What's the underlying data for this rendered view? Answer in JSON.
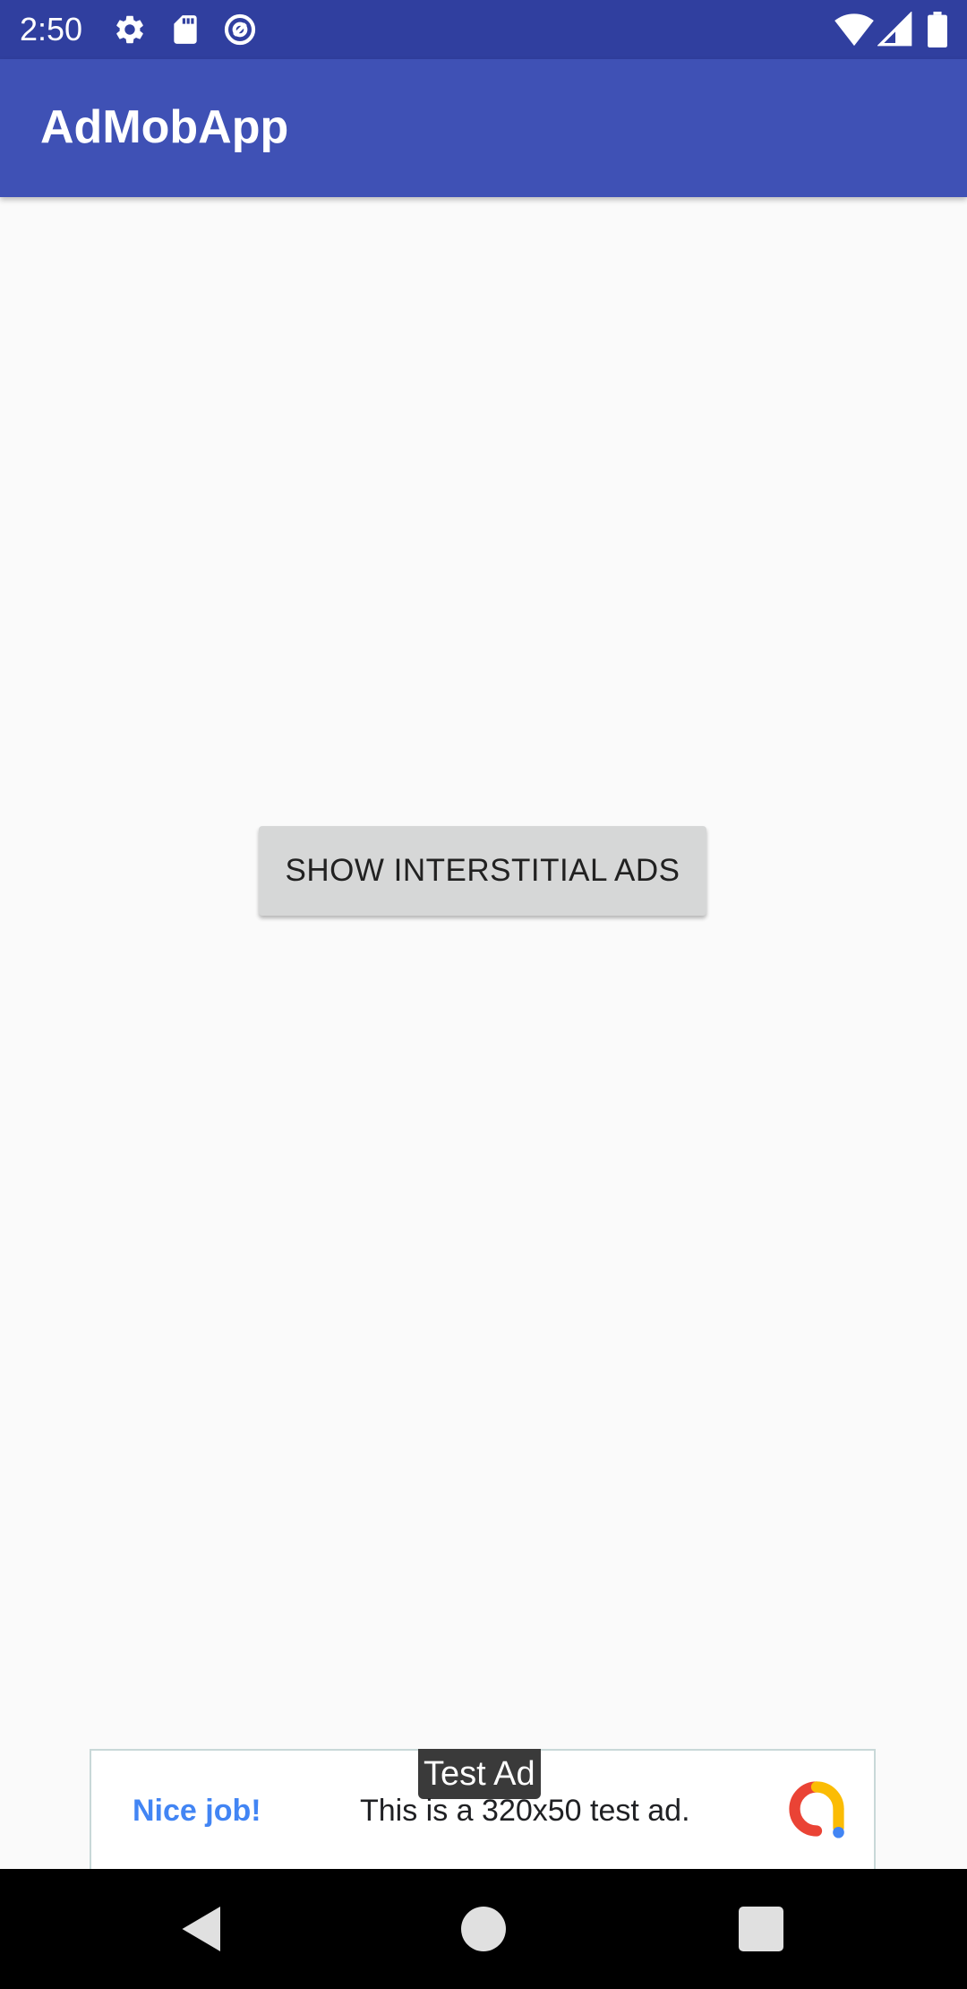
{
  "status_bar": {
    "time": "2:50",
    "icons": [
      "gear-icon",
      "sd-card-icon",
      "at-sign-icon",
      "wifi-icon",
      "signal-icon",
      "battery-icon"
    ]
  },
  "app_bar": {
    "title": "AdMobApp"
  },
  "main": {
    "button_label": "SHOW INTERSTITIAL ADS"
  },
  "ad": {
    "tag": "Test Ad",
    "left_text": "Nice job!",
    "body_text": "This is a 320x50 test ad.",
    "logo_icon": "admob-logo-icon"
  },
  "nav_bar": {
    "buttons": [
      "back-icon",
      "home-icon",
      "recents-icon"
    ]
  },
  "colors": {
    "status_bar": "#303f9f",
    "app_bar": "#3f51b5",
    "background": "#fafafa",
    "button": "#d6d7d7",
    "nav_bar": "#000000"
  }
}
